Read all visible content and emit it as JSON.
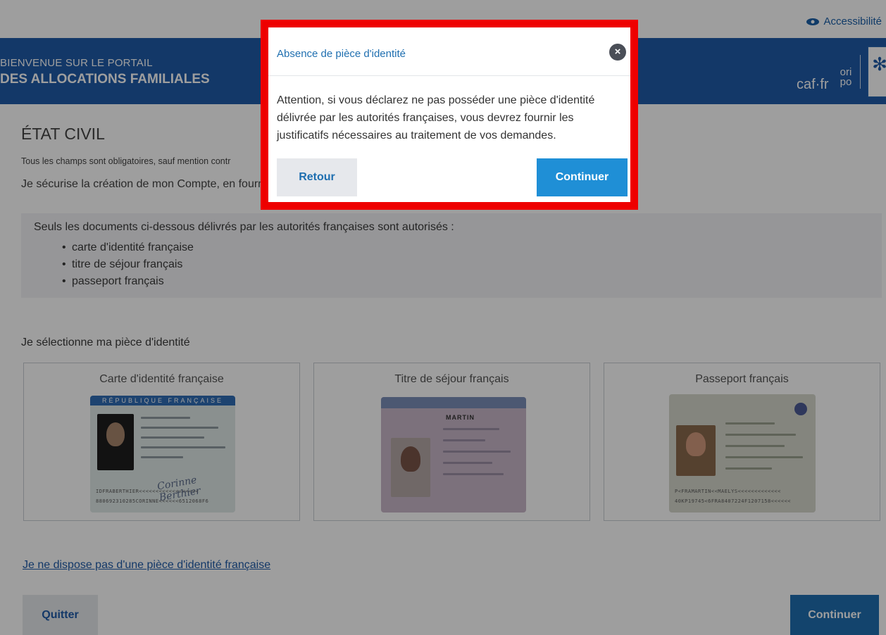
{
  "topbar": {
    "accessibility_label": "Accessibilité"
  },
  "header": {
    "welcome_line1": "BIENVENUE SUR LE PORTAIL",
    "welcome_line2": "DES ALLOCATIONS FAMILIALES",
    "caf_logo": "caf·fr",
    "oripo_logo": "ori po"
  },
  "main": {
    "title": "ÉTAT CIVIL",
    "required_note": "Tous les champs sont obligatoires, sauf mention contr",
    "secure_text": "Je sécurise la création de mon Compte, en fourn",
    "info_title": "Seuls les documents ci-dessous délivrés par les autorités françaises sont autorisés :",
    "info_items": [
      "carte d'identité française",
      "titre de séjour français",
      "passeport français"
    ],
    "select_label": "Je sélectionne ma pièce d'identité",
    "cards": [
      {
        "title": "Carte d'identité française",
        "band_text": "RÉPUBLIQUE FRANÇAISE"
      },
      {
        "title": "Titre de séjour français",
        "name_text": "MARTIN"
      },
      {
        "title": "Passeport français"
      }
    ],
    "no_id_link": "Je ne dispose pas d'une pièce d'identité française",
    "quit_button": "Quitter",
    "continue_button": "Continuer"
  },
  "modal": {
    "title": "Absence de pièce d'identité",
    "close_symbol": "×",
    "body": "Attention, si vous déclarez ne pas posséder une pièce d'identité délivrée par les autorités françaises, vous devrez fournir les justificatifs nécessaires au traitement de vos demandes.",
    "back_button": "Retour",
    "continue_button": "Continuer"
  },
  "colors": {
    "header_blue": "#1f5ba9",
    "highlight_red": "#ee0000",
    "primary_button": "#1f8fd6"
  },
  "icons": {
    "accessibility": "eye-icon",
    "close": "close-icon",
    "emblem": "snowflake-emblem-icon"
  }
}
